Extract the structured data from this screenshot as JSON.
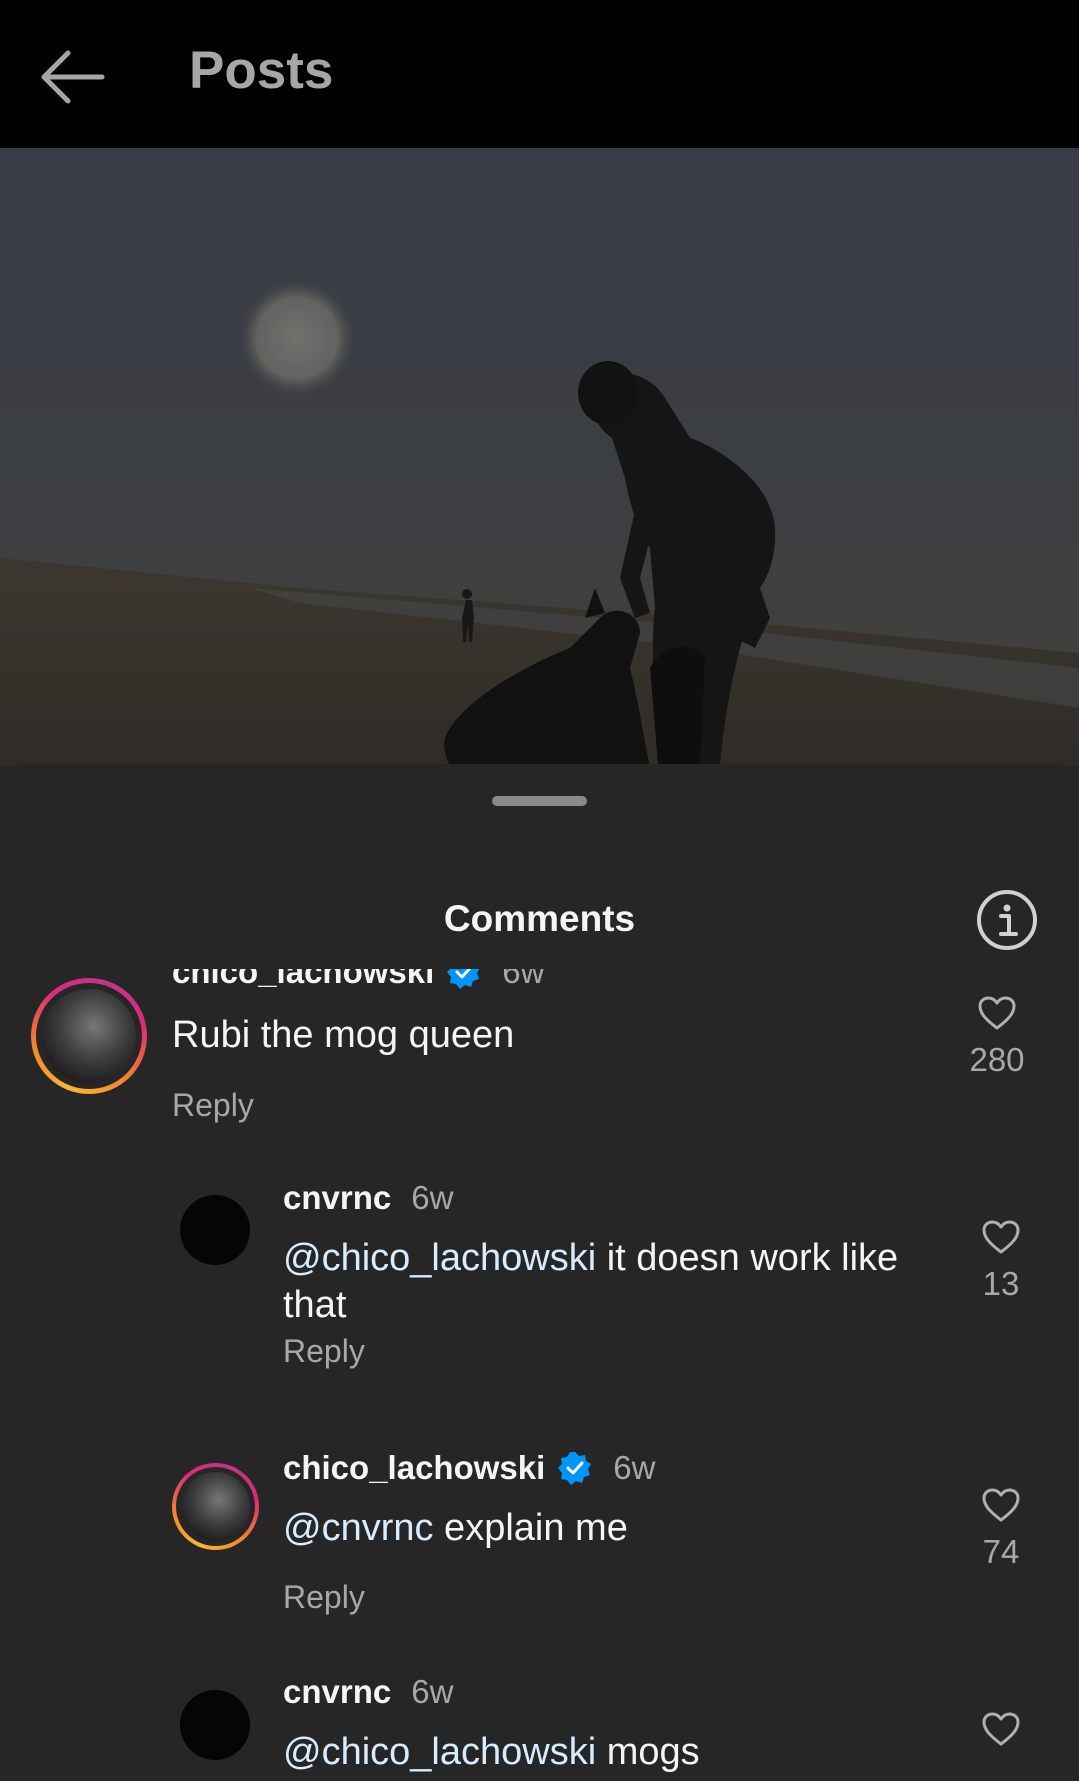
{
  "header": {
    "title": "Posts"
  },
  "sheet": {
    "title": "Comments"
  },
  "comments": [
    {
      "username": "chico_lachowski",
      "verified": true,
      "time": "6w",
      "text": "Rubi the mog queen",
      "mention": "",
      "reply": "Reply",
      "likes": "280"
    },
    {
      "username": "cnvrnc",
      "verified": false,
      "time": "6w",
      "mention": "@chico_lachowski",
      "text": " it doesn work like that",
      "reply": "Reply",
      "likes": "13"
    },
    {
      "username": "chico_lachowski",
      "verified": true,
      "time": "6w",
      "mention": "@cnvrnc",
      "text": " explain me",
      "reply": "Reply",
      "likes": "74"
    },
    {
      "username": "cnvrnc",
      "verified": false,
      "time": "6w",
      "mention": "@chico_lachowski",
      "text": " mogs",
      "reply": "",
      "likes": ""
    }
  ],
  "icons": {
    "back": "arrow-left-icon",
    "info": "info-icon",
    "like": "heart-icon",
    "verified": "verified-badge-icon"
  },
  "colors": {
    "verified": "#0095f6",
    "story_ring_start": "#f7b733",
    "story_ring_end": "#c13584"
  }
}
